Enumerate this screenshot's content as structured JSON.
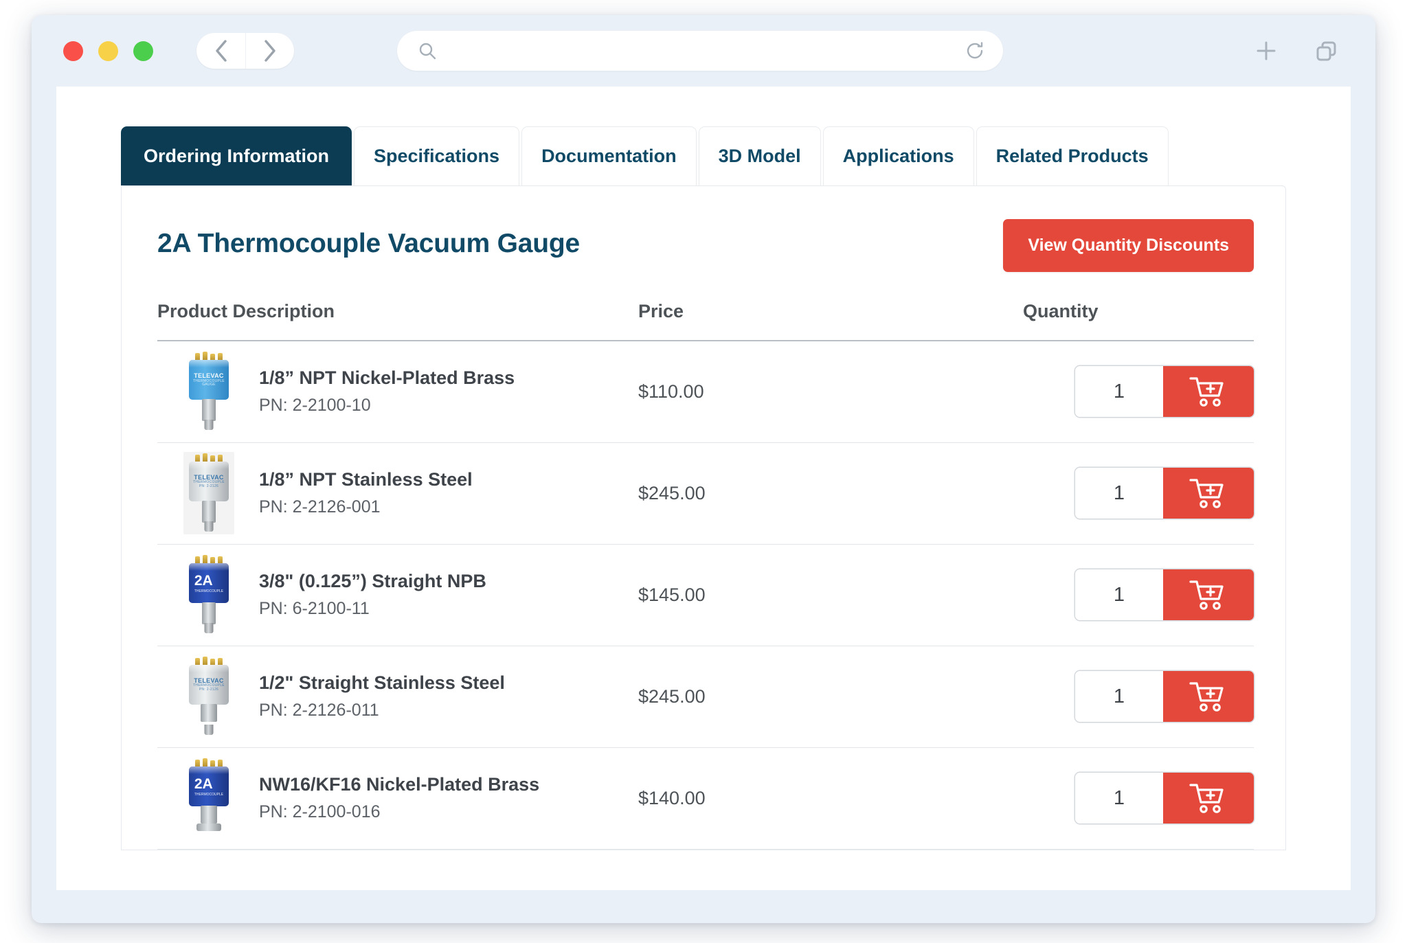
{
  "browser": {
    "window_controls": [
      "close",
      "minimize",
      "maximize"
    ],
    "back_label": "Back",
    "forward_label": "Forward",
    "url_value": "",
    "url_placeholder": "",
    "reload_label": "Reload",
    "new_tab_label": "New Tab",
    "tab_overview_label": "Tab Overview"
  },
  "tabs": [
    {
      "label": "Ordering Information",
      "active": true
    },
    {
      "label": "Specifications",
      "active": false
    },
    {
      "label": "Documentation",
      "active": false
    },
    {
      "label": "3D Model",
      "active": false
    },
    {
      "label": "Applications",
      "active": false
    },
    {
      "label": "Related Products",
      "active": false
    }
  ],
  "product": {
    "title": "2A Thermocouple Vacuum Gauge",
    "discount_button": "View Quantity Discounts"
  },
  "table": {
    "headers": {
      "description": "Product Description",
      "price": "Price",
      "quantity": "Quantity"
    },
    "rows": [
      {
        "name": "1/8” NPT Nickel-Plated Brass",
        "pn": "PN: 2-2100-10",
        "price": "$110.00",
        "qty": "1",
        "thumb_style": "blue",
        "thumb_text": "TELEVAC",
        "cart_label": "Add to cart"
      },
      {
        "name": "1/8” NPT Stainless Steel",
        "pn": "PN: 2-2126-001",
        "price": "$245.00",
        "qty": "1",
        "thumb_style": "silver",
        "thumb_text": "TELEVAC",
        "cart_label": "Add to cart"
      },
      {
        "name": "3/8\" (0.125”) Straight NPB",
        "pn": "PN: 6-2100-11",
        "price": "$145.00",
        "qty": "1",
        "thumb_style": "navy",
        "thumb_text": "2A",
        "cart_label": "Add to cart"
      },
      {
        "name": "1/2\" Straight Stainless Steel",
        "pn": "PN: 2-2126-011",
        "price": "$245.00",
        "qty": "1",
        "thumb_style": "silver",
        "thumb_text": "TELEVAC",
        "cart_label": "Add to cart"
      },
      {
        "name": "NW16/KF16 Nickel-Plated Brass",
        "pn": "PN: 2-2100-016",
        "price": "$140.00",
        "qty": "1",
        "thumb_style": "navy",
        "thumb_text": "2A",
        "cart_label": "Add to cart"
      }
    ]
  },
  "colors": {
    "tab_active_bg": "#0c3c54",
    "tab_text": "#104a66",
    "accent_red": "#e4483a",
    "title_navy": "#114a66",
    "page_bg": "#eaf0f7"
  }
}
